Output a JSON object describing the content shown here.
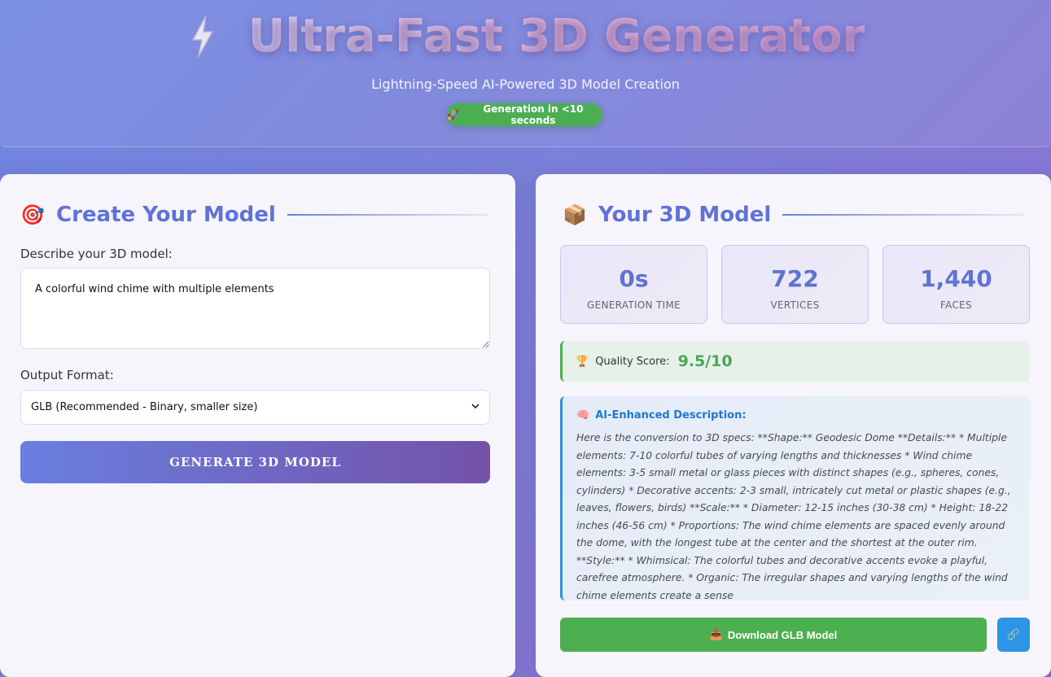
{
  "hero": {
    "title": "Ultra-Fast 3D Generator",
    "subtitle": "Lightning-Speed AI-Powered 3D Model Creation",
    "badge": "Generation in <10 seconds",
    "badge_icon": "🚀"
  },
  "create": {
    "icon": "🎯",
    "heading": "Create Your Model",
    "prompt_label": "Describe your 3D model:",
    "prompt_value": "A colorful wind chime with multiple elements",
    "format_label": "Output Format:",
    "format_selected": "GLB (Recommended - Binary, smaller size)",
    "generate_label": "GENERATE 3D MODEL"
  },
  "result": {
    "icon": "📦",
    "heading": "Your 3D Model",
    "stats": [
      {
        "value": "0s",
        "label": "GENERATION TIME"
      },
      {
        "value": "722",
        "label": "VERTICES"
      },
      {
        "value": "1,440",
        "label": "FACES"
      }
    ],
    "quality_icon": "🏆",
    "quality_label": "Quality Score:",
    "quality_value": "9.5/10",
    "desc_icon": "🧠",
    "desc_heading": "AI-Enhanced Description:",
    "desc_text": "Here is the conversion to 3D specs: **Shape:** Geodesic Dome **Details:** * Multiple elements: 7-10 colorful tubes of varying lengths and thicknesses * Wind chime elements: 3-5 small metal or glass pieces with distinct shapes (e.g., spheres, cones, cylinders) * Decorative accents: 2-3 small, intricately cut metal or plastic shapes (e.g., leaves, flowers, birds) **Scale:** * Diameter: 12-15 inches (30-38 cm) * Height: 18-22 inches (46-56 cm) * Proportions: The wind chime elements are spaced evenly around the dome, with the longest tube at the center and the shortest at the outer rim. **Style:** * Whimsical: The colorful tubes and decorative accents evoke a playful, carefree atmosphere. * Organic: The irregular shapes and varying lengths of the wind chime elements create a sense",
    "download_icon": "📥",
    "download_label": "Download GLB Model",
    "link_icon": "🔗"
  },
  "colors": {
    "accent": "#6072d8",
    "success": "#4caf50",
    "info": "#2d95e6"
  }
}
